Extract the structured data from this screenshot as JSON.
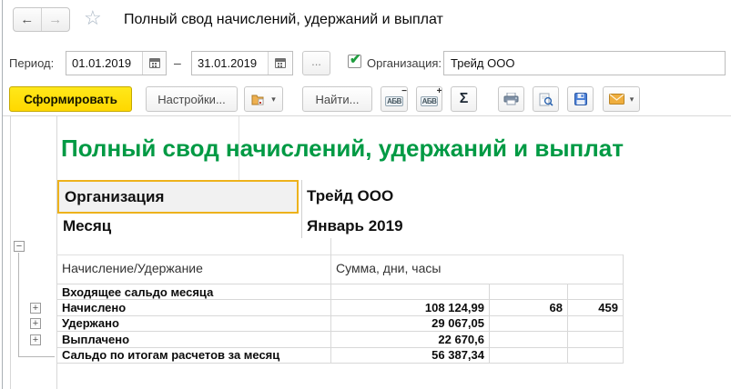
{
  "window": {
    "title": "Полный свод начислений, удержаний и выплат"
  },
  "icons": {
    "back": "←",
    "forward": "→",
    "star": "☆",
    "dropdown": "▾",
    "sigma": "Σ",
    "abc": "АБВ",
    "abc_minus": "−",
    "abc_plus": "+",
    "check": "✔",
    "tree_minus": "−",
    "tree_plus": "+",
    "ellipsis": "..."
  },
  "filters": {
    "period_label": "Период:",
    "date_from": "01.01.2019",
    "date_to": "31.01.2019",
    "range_dash": "–",
    "org_label": "Организация:",
    "org_value": "Трейд ООО"
  },
  "toolbar": {
    "generate": "Сформировать",
    "settings": "Настройки...",
    "find": "Найти..."
  },
  "report": {
    "title": "Полный свод начислений, удержаний и выплат",
    "fields": [
      {
        "label": "Организация",
        "value": "Трейд ООО"
      },
      {
        "label": "Месяц",
        "value": "Январь 2019"
      }
    ],
    "columns": {
      "c1": "Начисление/Удержание",
      "c2": "Сумма, дни, часы"
    },
    "rows": [
      {
        "label": "Входящее сальдо месяца",
        "sum": "",
        "days": "",
        "hours": ""
      },
      {
        "label": "Начислено",
        "sum": "108 124,99",
        "days": "68",
        "hours": "459"
      },
      {
        "label": "Удержано",
        "sum": "29 067,05",
        "days": "",
        "hours": ""
      },
      {
        "label": "Выплачено",
        "sum": "22 670,6",
        "days": "",
        "hours": ""
      },
      {
        "label": "Сальдо по итогам расчетов за месяц",
        "sum": "56 387,34",
        "days": "",
        "hours": ""
      }
    ]
  },
  "colors": {
    "accent_green": "#009a44",
    "button_yellow": "#ffe100",
    "selected_cell_border": "#edb21c",
    "grid_line": "#d8d8d8"
  }
}
